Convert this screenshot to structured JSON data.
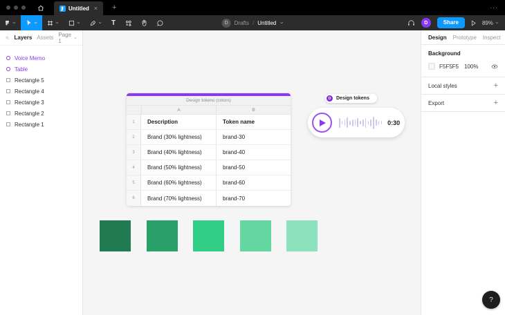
{
  "colors": {
    "accent_blue": "#0d99ff",
    "accent_purple": "#8a38f5",
    "canvas_bg": "#f5f5f5"
  },
  "tab_bar": {
    "title": "Untitled",
    "close": "×",
    "new_tab": "+",
    "more": "···"
  },
  "toolbar": {
    "breadcrumb": {
      "avatar": "D",
      "root": "Drafts",
      "separator": "/",
      "title": "Untitled"
    },
    "share": "Share",
    "zoom": "89%",
    "user_avatar": "D"
  },
  "left_sidebar": {
    "tabs": [
      {
        "label": "Layers",
        "active": true
      },
      {
        "label": "Assets",
        "active": false
      }
    ],
    "page": "Page 1",
    "layers": [
      {
        "name": "Voice Memo",
        "is_widget": true
      },
      {
        "name": "Table",
        "is_widget": true
      },
      {
        "name": "Rectangle 5"
      },
      {
        "name": "Rectangle 4"
      },
      {
        "name": "Rectangle 3"
      },
      {
        "name": "Rectangle 2"
      },
      {
        "name": "Rectangle 1"
      }
    ]
  },
  "canvas": {
    "table": {
      "title": "Design tokens (colors)",
      "column_headers": [
        "A",
        "B"
      ],
      "rows": [
        {
          "num": "1",
          "a": "Description",
          "b": "Token name",
          "is_header": true
        },
        {
          "num": "2",
          "a": "Brand (30% lightness)",
          "b": "brand-30"
        },
        {
          "num": "3",
          "a": "Brand (40% lightness)",
          "b": "brand-40"
        },
        {
          "num": "4",
          "a": "Brand (50% lightness)",
          "b": "brand-50"
        },
        {
          "num": "5",
          "a": "Brand (60% lightness)",
          "b": "brand-60"
        },
        {
          "num": "6",
          "a": "Brand (70% lightness)",
          "b": "brand-70"
        }
      ]
    },
    "voice_memo": {
      "label": "Design tokens",
      "badge": "D",
      "duration": "0:30",
      "waveform": [
        14,
        5,
        9,
        15,
        6,
        10,
        9,
        13,
        5,
        10,
        14,
        6,
        10,
        18,
        9,
        6,
        5
      ]
    },
    "swatches": [
      "#207a52",
      "#2aa069",
      "#2fcd86",
      "#64d6a0",
      "#8ce2bc"
    ]
  },
  "right_panel": {
    "tabs": [
      {
        "label": "Design",
        "active": true
      },
      {
        "label": "Prototype",
        "active": false
      },
      {
        "label": "Inspect",
        "active": false
      }
    ],
    "background": {
      "label": "Background",
      "hex": "F5F5F5",
      "opacity": "100%"
    },
    "sections": [
      {
        "label": "Local styles",
        "action": "+"
      },
      {
        "label": "Export",
        "action": "+"
      }
    ],
    "help": "?"
  }
}
